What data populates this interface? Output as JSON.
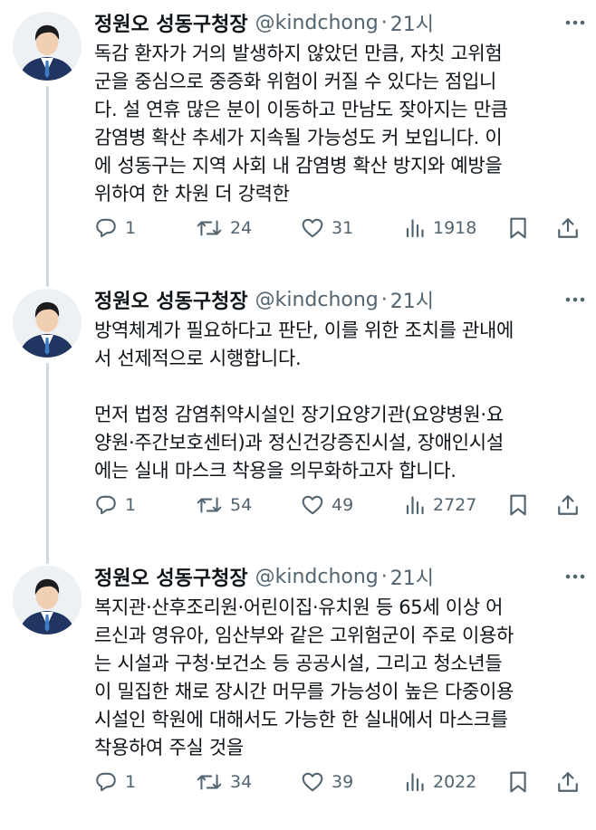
{
  "colors": {
    "text_primary": "#0f1419",
    "text_secondary": "#536471",
    "thread_line": "#cfd9de",
    "background": "#ffffff"
  },
  "icons": {
    "more": "more-dots-icon",
    "reply": "reply-icon",
    "retweet": "retweet-icon",
    "like": "heart-icon",
    "views": "views-bar-chart-icon",
    "bookmark": "bookmark-icon",
    "share": "share-icon"
  },
  "tweets": [
    {
      "author": "정원오 성동구청장",
      "handle": "@kindchong",
      "separator": "·",
      "time": "21시",
      "text": "독감 환자가 거의 발생하지 않았던 만큼, 자칫 고위험\n군을 중심으로 중증화 위험이 커질 수 있다는 점입니\n다. 설 연휴 많은 분이 이동하고 만남도 잦아지는 만큼\n감염병 확산 추세가 지속될 가능성도 커 보입니다. 이\n에 성동구는 지역 사회 내 감염병 확산 방지와 예방을\n위하여 한 차원 더 강력한",
      "replies": "1",
      "retweets": "24",
      "likes": "31",
      "views": "1918"
    },
    {
      "author": "정원오 성동구청장",
      "handle": "@kindchong",
      "separator": "·",
      "time": "21시",
      "text": "방역체계가 필요하다고 판단, 이를 위한 조치를 관내에\n서 선제적으로 시행합니다.\n\n먼저 법정 감염취약시설인 장기요양기관(요양병원·요\n양원·주간보호센터)과 정신건강증진시설, 장애인시설\n에는 실내 마스크 착용을 의무화하고자 합니다.",
      "replies": "1",
      "retweets": "54",
      "likes": "49",
      "views": "2727"
    },
    {
      "author": "정원오 성동구청장",
      "handle": "@kindchong",
      "separator": "·",
      "time": "21시",
      "text": "복지관·산후조리원·어린이집·유치원 등 65세 이상 어\n르신과 영유아, 임산부와 같은 고위험군이 주로 이용하\n는 시설과 구청·보건소 등 공공시설, 그리고 청소년들\n이 밀집한 채로 장시간 머무를 가능성이 높은 다중이용\n시설인 학원에 대해서도 가능한 한 실내에서 마스크를\n착용하여 주실 것을",
      "replies": "1",
      "retweets": "34",
      "likes": "39",
      "views": "2022"
    }
  ]
}
